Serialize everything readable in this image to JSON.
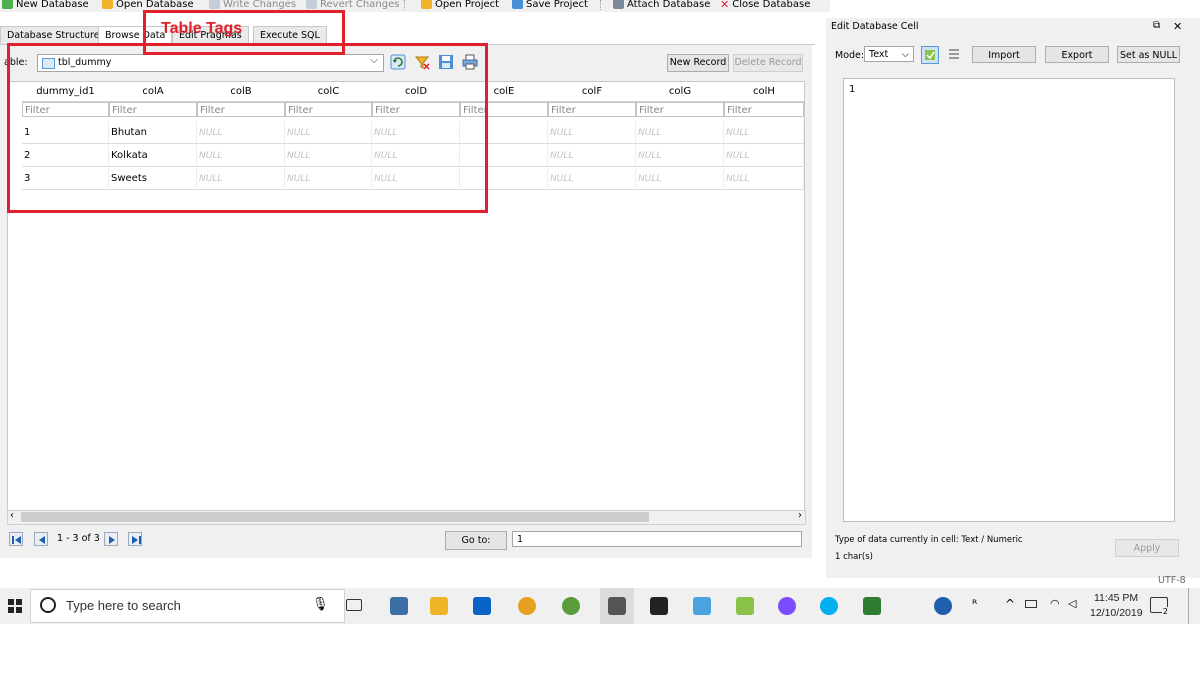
{
  "toolbar": {
    "items": [
      {
        "label": "New Database",
        "icon": "new-database-icon",
        "color": "#4caf50",
        "disabled": false
      },
      {
        "label": "Open Database",
        "icon": "open-database-icon",
        "color": "#f0b429",
        "disabled": false
      },
      {
        "label": "Write Changes",
        "icon": "write-changes-icon",
        "color": "#9aa7b5",
        "disabled": true
      },
      {
        "label": "Revert Changes",
        "icon": "revert-changes-icon",
        "color": "#9aa7b5",
        "disabled": true
      },
      {
        "label": "Open Project",
        "icon": "open-project-icon",
        "color": "#f0b429",
        "disabled": false
      },
      {
        "label": "Save Project",
        "icon": "save-project-icon",
        "color": "#4a90d9",
        "disabled": false
      },
      {
        "label": "Attach Database",
        "icon": "attach-database-icon",
        "color": "#7a8a99",
        "disabled": false
      },
      {
        "label": "Close Database",
        "icon": "close-database-icon",
        "color": "#e0202a",
        "disabled": false
      }
    ]
  },
  "tabs": [
    {
      "label": "Database Structure",
      "active": false
    },
    {
      "label": "Browse Data",
      "active": true
    },
    {
      "label": "Edit Pragmas",
      "active": false
    },
    {
      "label": "Execute SQL",
      "active": false
    }
  ],
  "annotation": {
    "label": "Table Tags",
    "color": "#e0202a"
  },
  "browse": {
    "table_label": "able:",
    "table_value": "tbl_dummy",
    "new_record": "New Record",
    "delete_record": "Delete Record",
    "columns": [
      "dummy_id1",
      "colA",
      "colB",
      "colC",
      "colD",
      "colE",
      "colF",
      "colG",
      "colH"
    ],
    "filter_placeholder": "Filter",
    "row_numbers": [
      "1",
      "2",
      "3"
    ],
    "rows": [
      [
        "1",
        "Bhutan",
        "NULL",
        "NULL",
        "NULL",
        "",
        "NULL",
        "NULL",
        "NULL"
      ],
      [
        "2",
        "Kolkata",
        "NULL",
        "NULL",
        "NULL",
        "",
        "NULL",
        "NULL",
        "NULL"
      ],
      [
        "3",
        "Sweets",
        "NULL",
        "NULL",
        "NULL",
        "",
        "NULL",
        "NULL",
        "NULL"
      ]
    ],
    "record_count": "1 - 3 of 3",
    "goto_label": "Go to:",
    "goto_value": "1"
  },
  "edit_cell": {
    "title": "Edit Database Cell",
    "mode_label": "Mode:",
    "mode_value": "Text",
    "import": "Import",
    "export": "Export",
    "set_null": "Set as NULL",
    "content": "1",
    "type_info": "Type of data currently in cell: Text / Numeric",
    "char_count": "1 char(s)",
    "apply": "Apply",
    "encoding": "UTF-8"
  },
  "taskbar": {
    "search_placeholder": "Type here to search",
    "time": "11:45 PM",
    "date": "12/10/2019",
    "notification_count": "2"
  }
}
